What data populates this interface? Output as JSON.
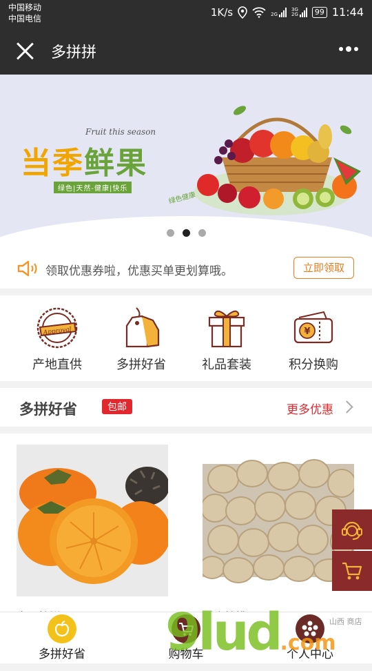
{
  "status_bar": {
    "carrier1": "中国移动",
    "carrier2": "中国电信",
    "speed": "1K/s",
    "net1": "2G",
    "net2": "3G",
    "net3": "2G",
    "battery": "99",
    "time": "11:44"
  },
  "titlebar": {
    "title": "多拼拼",
    "close_icon": "close-icon",
    "more_icon": "more-dots-icon"
  },
  "banner": {
    "script_text": "Fruit this season",
    "title_part1": "当季",
    "title_part2": "鲜果",
    "subtitle": "绿色|天然-健康|快乐",
    "sign_text": "绿色健康",
    "active_dot": 1
  },
  "notice": {
    "icon": "speaker-icon",
    "text": "领取优惠券啦，优惠买单更划算哦。",
    "button": "立即领取"
  },
  "categories": [
    {
      "label": "产地直供",
      "icon": "approval-seal-icon"
    },
    {
      "label": "多拼好省",
      "icon": "price-tag-icon"
    },
    {
      "label": "礼品套装",
      "icon": "gift-box-icon"
    },
    {
      "label": "积分换购",
      "icon": "yen-ticket-icon"
    }
  ],
  "section": {
    "title": "多拼好省",
    "badge": "包邮",
    "more": "更多优惠"
  },
  "products": [
    {
      "name": "富平柿饼",
      "image": "persimmon-image"
    },
    {
      "name": "纸皮核桃",
      "image": "walnut-image"
    }
  ],
  "float_buttons": [
    "customer-service-icon",
    "cart-icon"
  ],
  "tabbar": [
    {
      "label": "多拼好省",
      "icon": "apple-icon"
    },
    {
      "label": "购物车",
      "icon": "cart-icon"
    },
    {
      "label": "个人中心",
      "icon": "user-flower-icon"
    }
  ],
  "watermark": {
    "logo": "9lud",
    "logo_suffix": ".com",
    "shop_text": "山西 商店"
  },
  "colors": {
    "dark_bar": "#2e2e2e",
    "accent_orange": "#e67e1e",
    "accent_red": "#e0282e",
    "brand_maroon": "#8a2a2a",
    "banner_green": "#6aa33a"
  }
}
